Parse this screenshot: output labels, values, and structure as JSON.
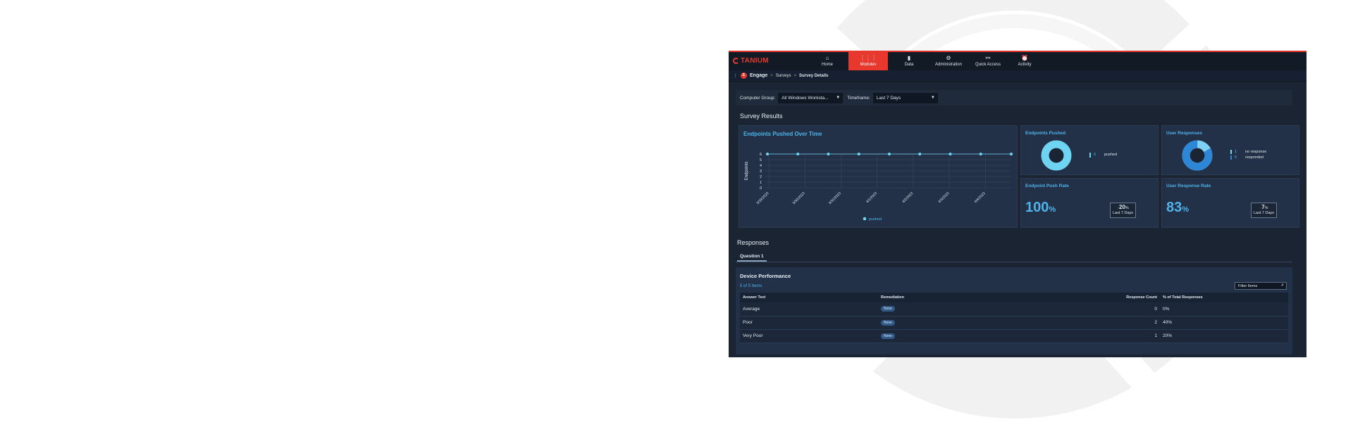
{
  "brand": {
    "logo_text": "TANIUM"
  },
  "nav": [
    {
      "label": "Home",
      "icon": "home-icon",
      "glyph": "⌂"
    },
    {
      "label": "Modules",
      "icon": "grid-icon",
      "glyph": "⋮⋮⋮"
    },
    {
      "label": "Data",
      "icon": "bar-chart-icon",
      "glyph": "▮"
    },
    {
      "label": "Administration",
      "icon": "gear-icon",
      "glyph": "⚙"
    },
    {
      "label": "Quick Access",
      "icon": "link-icon",
      "glyph": "⚯"
    },
    {
      "label": "Activity",
      "icon": "alarm-icon",
      "glyph": "⏰"
    }
  ],
  "breadcrumb": {
    "app": "Engage",
    "parent": "Surveys",
    "sep": ">",
    "current": "Survey Details"
  },
  "filters": {
    "group_label": "Computer Group:",
    "group_value": "All Windows Worksta...",
    "timeframe_label": "Timeframe:",
    "timeframe_value": "Last 7 Days"
  },
  "survey_results_title": "Survey Results",
  "endpoints_chart": {
    "title": "Endpoints Pushed Over Time",
    "ylabel": "Endpoints",
    "legend": "pushed"
  },
  "chart_data": {
    "type": "line",
    "title": "Endpoints Pushed Over Time",
    "ylabel": "Endpoints",
    "ylim": [
      0,
      6
    ],
    "yticks": [
      "0",
      "1",
      "2",
      "3",
      "4",
      "5",
      "6"
    ],
    "x_tick_labels": [
      "3/29/2023",
      "3/30/2023",
      "3/31/2023",
      "4/1/2023",
      "4/2/2023",
      "4/3/2023",
      "4/4/2023"
    ],
    "series": [
      {
        "name": "pushed",
        "values": [
          6,
          6,
          6,
          6,
          6,
          6,
          6,
          6,
          6
        ]
      }
    ],
    "color": "#6fd3f2",
    "grid": true
  },
  "endpoints_pushed": {
    "title": "Endpoints Pushed",
    "value": "6",
    "label": "pushed",
    "fraction": 1.0
  },
  "user_responses": {
    "title": "User Responses",
    "items": [
      {
        "value": "1",
        "label": "no response"
      },
      {
        "value": "5",
        "label": "responded"
      }
    ],
    "fraction_responded": 0.83
  },
  "push_rate": {
    "title": "Endpoint Push Rate",
    "value": "100",
    "unit": "%",
    "delta_arrow": "↑",
    "delta": "20",
    "delta_unit": "%",
    "delta_period": "Last 7 Days"
  },
  "response_rate": {
    "title": "User Response Rate",
    "value": "83",
    "unit": "%",
    "delta_arrow": "↓",
    "delta": "7",
    "delta_unit": "%",
    "delta_period": "Last 7 Days"
  },
  "responses_title": "Responses",
  "tabs": [
    "Question 1"
  ],
  "device_performance": {
    "title": "Device Performance",
    "count_text": "5 of 5 Items",
    "filter_placeholder": "Filter Items",
    "columns": [
      "Answer Text",
      "Remediation",
      "Response Count",
      "% of Total Responses"
    ],
    "rows": [
      {
        "answer": "Average",
        "remediation": "None",
        "count": "0",
        "percent": "0%"
      },
      {
        "answer": "Poor",
        "remediation": "None",
        "count": "2",
        "percent": "40%"
      },
      {
        "answer": "Very Poor",
        "remediation": "None",
        "count": "1",
        "percent": "20%"
      }
    ]
  },
  "colors": {
    "accent": "#e8382e",
    "blue": "#4fb3ea",
    "cyan": "#6fd3f2",
    "background": "#1a2433"
  }
}
